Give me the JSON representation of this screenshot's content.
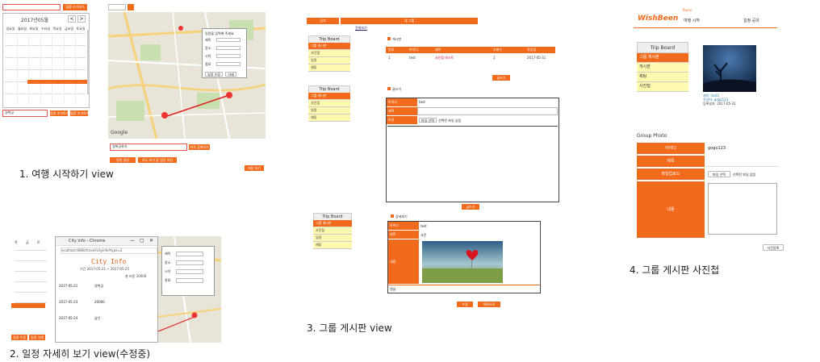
{
  "captions": {
    "v1": "1. 여행 시작하기 view",
    "v2": "2. 일정 자세히 보기 view(수정중)",
    "v3": "3. 그룹 게시판 view",
    "v4": "4. 그룹 게시판 사진첩"
  },
  "panel1": {
    "calendar_title": "2017년05월",
    "prev": "<",
    "next": ">",
    "weekdays": [
      "일요일",
      "월요일",
      "화요일",
      "수요일",
      "목요일",
      "금요일",
      "토요일"
    ],
    "search_value": "경복궁",
    "add_button": "일정 추가하기",
    "map_search_value": "경복궁위치",
    "map_search_button": "위치 검색하기",
    "map_btns": [
      "일정 생성",
      "지도 보기 및 일정 저장"
    ],
    "save_button": "저장 하기",
    "popup_title": "일정을 입력해 주세요",
    "popup_rows": [
      "제목",
      "장소",
      "시작",
      "종료"
    ],
    "popup_buttons": [
      "일정 수정",
      "삭제"
    ],
    "map_brand": "Google"
  },
  "panel2": {
    "window_title": "City Info - Chrome",
    "url": "localhost:8080/travel/cityinfo?type=2",
    "heading": "City Info",
    "subtitle": "기간 2017-05-21 ~ 2017-05-25",
    "meta": "총 비용 20000",
    "rows": [
      [
        "2017-05-21",
        "경복궁"
      ],
      [
        "2017-05-23",
        "20000"
      ],
      [
        "2017-05-24",
        "남산"
      ]
    ],
    "weekdays_short": [
      "목",
      "금",
      "토"
    ],
    "popup_rows": [
      "제목",
      "장소",
      "시작",
      "종료"
    ],
    "mini_btns": [
      "일정 수정",
      "일정 삭제"
    ]
  },
  "panel3": {
    "top_tabs": [
      "공지",
      "내 그룹"
    ],
    "top_link": "전체보기",
    "board1": {
      "sidebar_title": "Trip Board",
      "items": [
        "그룹 게시판",
        "사진첩",
        "일정",
        "채팅"
      ],
      "section_title": "게시판",
      "columns": [
        "번호",
        "아이디",
        "제목",
        "조회수",
        "작성일"
      ],
      "row": [
        "1",
        "test",
        "사진첩 테스트",
        "1",
        "2017-05-31"
      ],
      "write_button": "글쓰기"
    },
    "board2": {
      "sidebar_title": "Trip Board",
      "items": [
        "그룹 게시판",
        "사진첩",
        "일정",
        "채팅"
      ],
      "section_title": "글쓰기",
      "labels": [
        "아이디",
        "제목",
        "파일"
      ],
      "id_value": "test",
      "file_btn": "파일 선택",
      "file_text": "선택된 파일 없음",
      "submit": "글쓰기"
    },
    "board3": {
      "sidebar_title": "Trip Board",
      "items": [
        "그룹 게시판",
        "사진첩",
        "일정",
        "채팅"
      ],
      "section_title": "상세보기",
      "labels": [
        "아이디",
        "제목",
        "내용",
        "댓글"
      ],
      "id_value": "test",
      "title_value": "사진",
      "buttons": [
        "수정",
        "목록으로"
      ]
    }
  },
  "panel4": {
    "logo": "WishBeen",
    "logo_sub": "Tourer",
    "nav": [
      "여행 시작",
      "일정 공유"
    ],
    "sidebar_title": "Trip Board",
    "items": [
      "그룹 게시판",
      "게시판",
      "채팅",
      "사진첩"
    ],
    "photo_caption": [
      "제목: test1",
      "작성자: gogo123",
      "등록일자: 2017-05-31"
    ],
    "section_title": "Group Photo",
    "form_labels": [
      "아이디",
      "제목",
      "파일업로드",
      "내용"
    ],
    "id_value": "gogo123",
    "file_btn": "파일 선택",
    "file_text": "선택된 파일 없음",
    "submit": "사진등록"
  },
  "colors": {
    "accent": "#f26a1b",
    "highlight": "#fff9b0",
    "map": "#e8e2d4"
  }
}
